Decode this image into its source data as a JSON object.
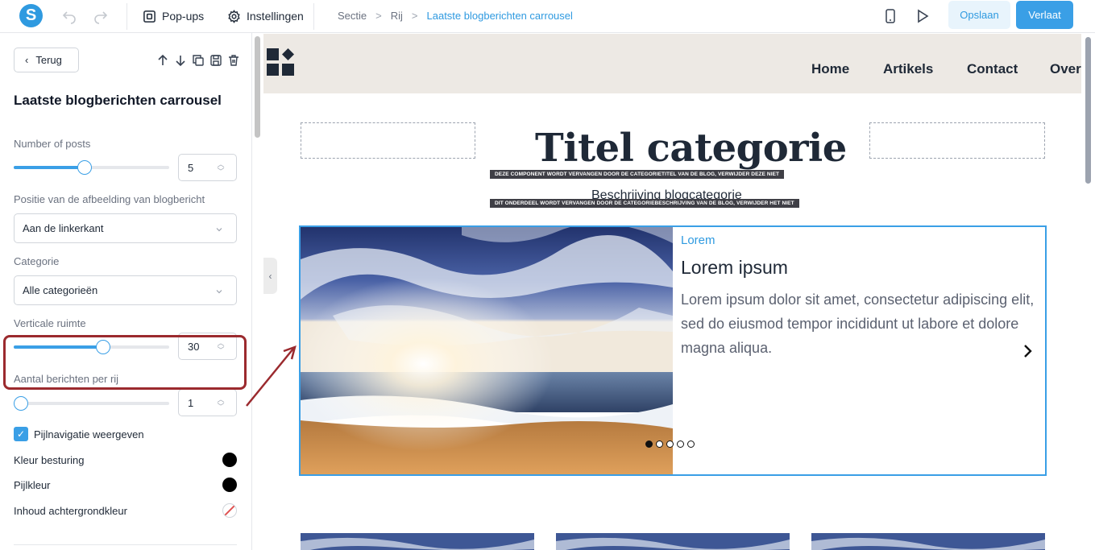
{
  "toolbar": {
    "logo_letter": "S",
    "popups_label": "Pop-ups",
    "settings_label": "Instellingen",
    "breadcrumb": [
      "Sectie",
      "Rij",
      "Laatste blogberichten carrousel"
    ],
    "save_label": "Opslaan",
    "leave_label": "Verlaat"
  },
  "sidebar": {
    "back_label": "Terug",
    "title": "Laatste blogberichten carrousel",
    "posts_label": "Number of posts",
    "posts_value": "5",
    "posts_fraction": 0.45,
    "image_position_label": "Positie van de afbeelding van blogbericht",
    "image_position_value": "Aan de linkerkant",
    "category_label": "Categorie",
    "category_value": "Alle categorieën",
    "vertical_space_label": "Verticale ruimte",
    "vertical_space_value": "30",
    "vertical_space_fraction": 0.58,
    "per_row_label": "Aantal berichten per rij",
    "per_row_value": "1",
    "per_row_fraction": 0.0,
    "arrow_nav_label": "Pijlnavigatie weergeven",
    "arrow_nav_checked": true,
    "control_color_label": "Kleur besturing",
    "arrow_color_label": "Pijlkleur",
    "content_bg_label": "Inhoud achtergrondkleur",
    "control_color": "#000000",
    "arrow_color": "#000000"
  },
  "site": {
    "nav": [
      "Home",
      "Artikels",
      "Contact",
      "Over"
    ],
    "category_title": "Titel categorie",
    "title_notice": "DEZE COMPONENT WORDT VERVANGEN DOOR DE CATEGORIETITEL VAN DE BLOG, VERWIJDER DEZE NIET",
    "category_description": "Beschrijving blogcategorie",
    "description_notice": "DIT ONDERDEEL WORDT VERVANGEN DOOR DE CATEGORIEBESCHRIJVING VAN DE BLOG, VERWIJDER HET NIET",
    "post": {
      "category": "Lorem",
      "title": "Lorem ipsum",
      "text": "Lorem ipsum dolor sit amet, consectetur adipiscing elit, sed do eiusmod tempor incididunt ut labore et dolore magna aliqua."
    },
    "dots_total": 5,
    "dots_active": 1
  },
  "colors": {
    "accent": "#3a9fe6",
    "highlight": "#9b2a2e"
  }
}
